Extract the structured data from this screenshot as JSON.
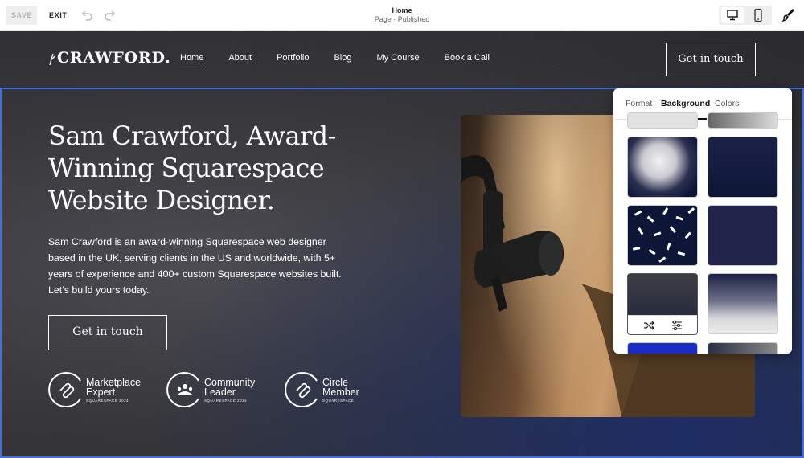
{
  "editor": {
    "save_label": "SAVE",
    "exit_label": "EXIT",
    "page_name": "Home",
    "page_status": "Page · Published"
  },
  "site": {
    "logo_text": "CRAWFORD.",
    "nav": [
      "Home",
      "About",
      "Portfolio",
      "Blog",
      "My Course",
      "Book a Call"
    ],
    "header_cta": "Get in touch",
    "hero_title": "Sam Crawford, Award-Winning Squarespace Website Designer.",
    "hero_body": "Sam Crawford is an award-winning Squarespace web designer based in the UK, serving clients in the US and worldwide, with 5+ years of experience and 400+ custom Squarespace websites built. Let’s build yours today.",
    "hero_cta": "Get in touch",
    "badges": [
      {
        "line1": "Marketplace",
        "line2": "Expert",
        "sub": "SQUARESPACE 2024"
      },
      {
        "line1": "Community",
        "line2": "Leader",
        "sub": "SQUARESPACE 2024"
      },
      {
        "line1": "Circle",
        "line2": "Member",
        "sub": "SQUARESPACE"
      }
    ]
  },
  "panel": {
    "tabs": [
      "Format",
      "Background",
      "Colors"
    ],
    "active_tab": "Background"
  },
  "colors": {
    "accent_blue": "#3d6fdd",
    "navy": "#0e1638"
  }
}
